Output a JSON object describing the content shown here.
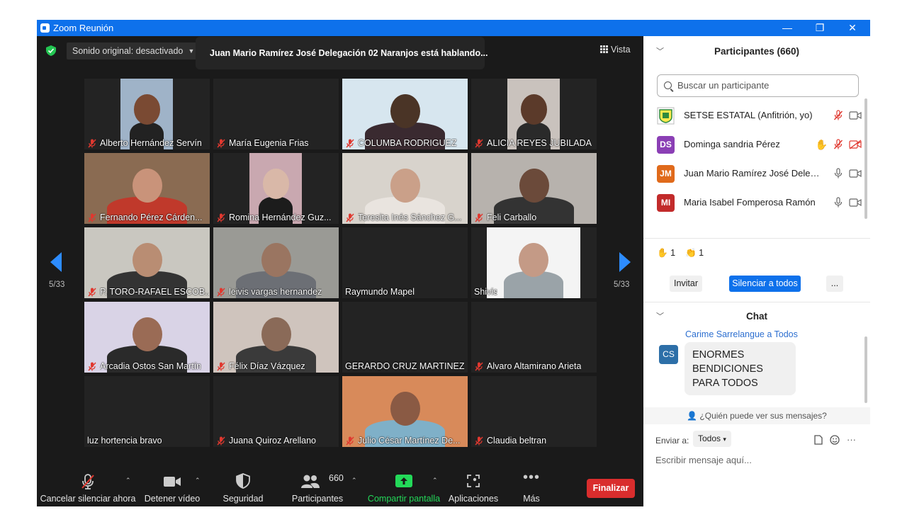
{
  "window": {
    "title": "Zoom Reunión"
  },
  "meeting": {
    "sound_original": "Sonido original: desactivado",
    "speaking_banner": "Juan Mario Ramírez José Delegación 02 Naranjos está hablando...",
    "view_label": "Vista",
    "page_indicator_left": "5/33",
    "page_indicator_right": "5/33"
  },
  "tiles": [
    {
      "name": "Alberto Hernández Servín",
      "muted": true
    },
    {
      "name": "María Eugenia Frias",
      "muted": true
    },
    {
      "name": "COLUMBA RODRIGUEZ",
      "muted": true
    },
    {
      "name": "ALICIA REYES JUBILADA",
      "muted": true
    },
    {
      "name": "Fernando Pérez Cárden...",
      "muted": true
    },
    {
      "name": "Romina Hernández Guz...",
      "muted": true
    },
    {
      "name": "Teresita Inés Sánchez G...",
      "muted": true
    },
    {
      "name": "Feli Carballo",
      "muted": true
    },
    {
      "name": "P. TORO-RAFAEL ESCOB...",
      "muted": true
    },
    {
      "name": "leivis vargas hernandez",
      "muted": true
    },
    {
      "name": "Raymundo Mapel",
      "muted": false
    },
    {
      "name": "Shivis",
      "muted": false
    },
    {
      "name": "Arcadia Ostos San Martín",
      "muted": true
    },
    {
      "name": "Félix Díaz Vázquez",
      "muted": true
    },
    {
      "name": "GERARDO CRUZ MARTINEZ",
      "muted": false
    },
    {
      "name": "Alvaro Altamirano Arieta",
      "muted": true
    },
    {
      "name": "luz hortencia bravo",
      "muted": false
    },
    {
      "name": "Juana Quiroz Arellano",
      "muted": true
    },
    {
      "name": "Julio César Martínez  De...",
      "muted": true
    },
    {
      "name": "Claudia beltran",
      "muted": true
    }
  ],
  "toolbar": {
    "unmute": "Cancelar silenciar ahora",
    "video": "Detener vídeo",
    "security": "Seguridad",
    "participants": "Participantes",
    "participants_count": "660",
    "share": "Compartir pantalla",
    "apps": "Aplicaciones",
    "more": "Más",
    "end": "Finalizar"
  },
  "participants_panel": {
    "title": "Participantes (660)",
    "search_placeholder": "Buscar un participante",
    "list": [
      {
        "initials": "",
        "name": "SETSE ESTATAL (Anfitrión, yo)",
        "avatar_color": "#ffffff",
        "hand": false,
        "mic": "muted",
        "video": "on"
      },
      {
        "initials": "DS",
        "name": "Dominga sandria Pérez",
        "avatar_color": "#8b3fb5",
        "hand": true,
        "mic": "muted",
        "video": "off"
      },
      {
        "initials": "JM",
        "name": "Juan Mario Ramírez José Deleg...",
        "avatar_color": "#e06a1b",
        "hand": false,
        "mic": "on",
        "video": "on"
      },
      {
        "initials": "MI",
        "name": "Maria Isabel Fomperosa Ramón",
        "avatar_color": "#c22b2b",
        "hand": false,
        "mic": "on",
        "video": "on"
      }
    ],
    "reaction_hand_count": "1",
    "reaction_clap_count": "1",
    "invite": "Invitar",
    "mute_all": "Silenciar a todos",
    "more": "..."
  },
  "chat": {
    "title": "Chat",
    "sender": "Carime Sarrelangue a Todos",
    "sender_initials": "CS",
    "message": "ENORMES BENDICIONES PARA TODOS",
    "who_can_see": "¿Quién puede ver sus mensajes?",
    "send_to_label": "Enviar a:",
    "send_to_value": "Todos",
    "input_placeholder": "Escribir mensaje aquí...",
    "more": "···"
  },
  "colors": {
    "title_bar": "#0e71eb",
    "accent": "#2d8cff",
    "end_button": "#d92d2d",
    "share_green": "#23d959",
    "mute_red": "#e0382f"
  }
}
